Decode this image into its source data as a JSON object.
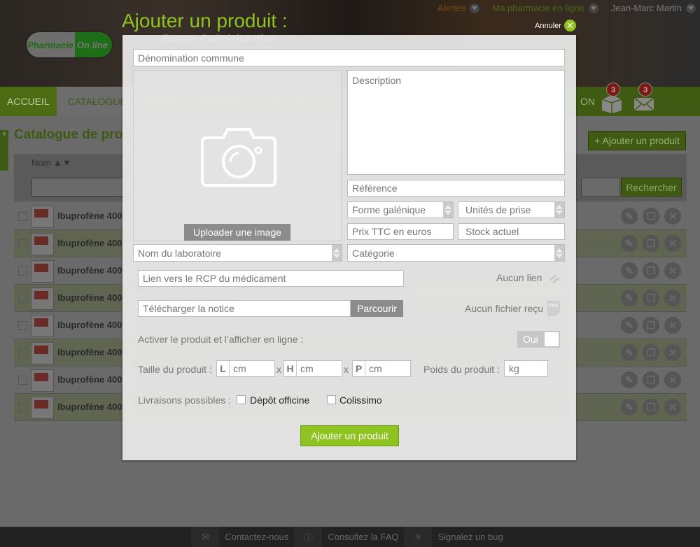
{
  "topnav": {
    "alerts": "Alertes",
    "pharmacy": "Ma pharmacie en ligne",
    "user": "Jean-Marc  Martin"
  },
  "logo": {
    "part1": "Pharmacie",
    "part2": "On line"
  },
  "header": {
    "subtitle": "Espace d'administration"
  },
  "nav": {
    "items": [
      "ACCUEIL",
      "CATALOGUE",
      "VENTES",
      "CLIENTS",
      "ACTUALITES",
      "ON"
    ],
    "badges": {
      "orders": "3",
      "messages": "3"
    }
  },
  "page": {
    "title": "Catalogue de produits",
    "add_button": "+ Ajouter un produit",
    "col_name": "Nom ▲▼",
    "search_button": "Rechercher",
    "rows": [
      "Ibuprofène 400",
      "Ibuprofène 400",
      "Ibuprofène 400",
      "Ibuprofène 400",
      "Ibuprofène 400",
      "Ibuprofène 400",
      "Ibuprofène 400",
      "Ibuprofène 400"
    ]
  },
  "modal": {
    "title": "Ajouter un produit :",
    "cancel": "Annuler",
    "fields": {
      "denomination": "Dénomination commune",
      "description": "Description",
      "reference": "Référence",
      "forme": "Forme galénique",
      "unites": "Unités de prise",
      "prix": "Prix TTC en euros",
      "stock": "Stock actuel",
      "laboratoire": "Nom du laboratoire",
      "categorie": "Catégorie",
      "rcp": "Lien vers le RCP du médicament",
      "notice": "Télécharger la notice"
    },
    "upload_image": "Uploader une image",
    "browse": "Parcourir",
    "no_link": "Aucun lien",
    "no_file": "Aucun fichier reçu",
    "activate_label": "Activer le produit et l’afficher en ligne :",
    "toggle": "Oui",
    "size_label": "Taille du produit :",
    "dims": [
      {
        "key": "L",
        "unit": "cm"
      },
      {
        "key": "H",
        "unit": "cm"
      },
      {
        "key": "P",
        "unit": "cm"
      }
    ],
    "times": "x",
    "weight_label": "Poids du produit :",
    "weight_unit": "kg",
    "delivery_label": "Livraisons possibles :",
    "delivery_options": [
      "Dépôt officine",
      "Colissimo"
    ],
    "submit": "Ajouter un produit"
  },
  "footer": {
    "contact": "Contactez-nous",
    "faq": "Consultez la FAQ",
    "bug": "Signalez un bug"
  }
}
